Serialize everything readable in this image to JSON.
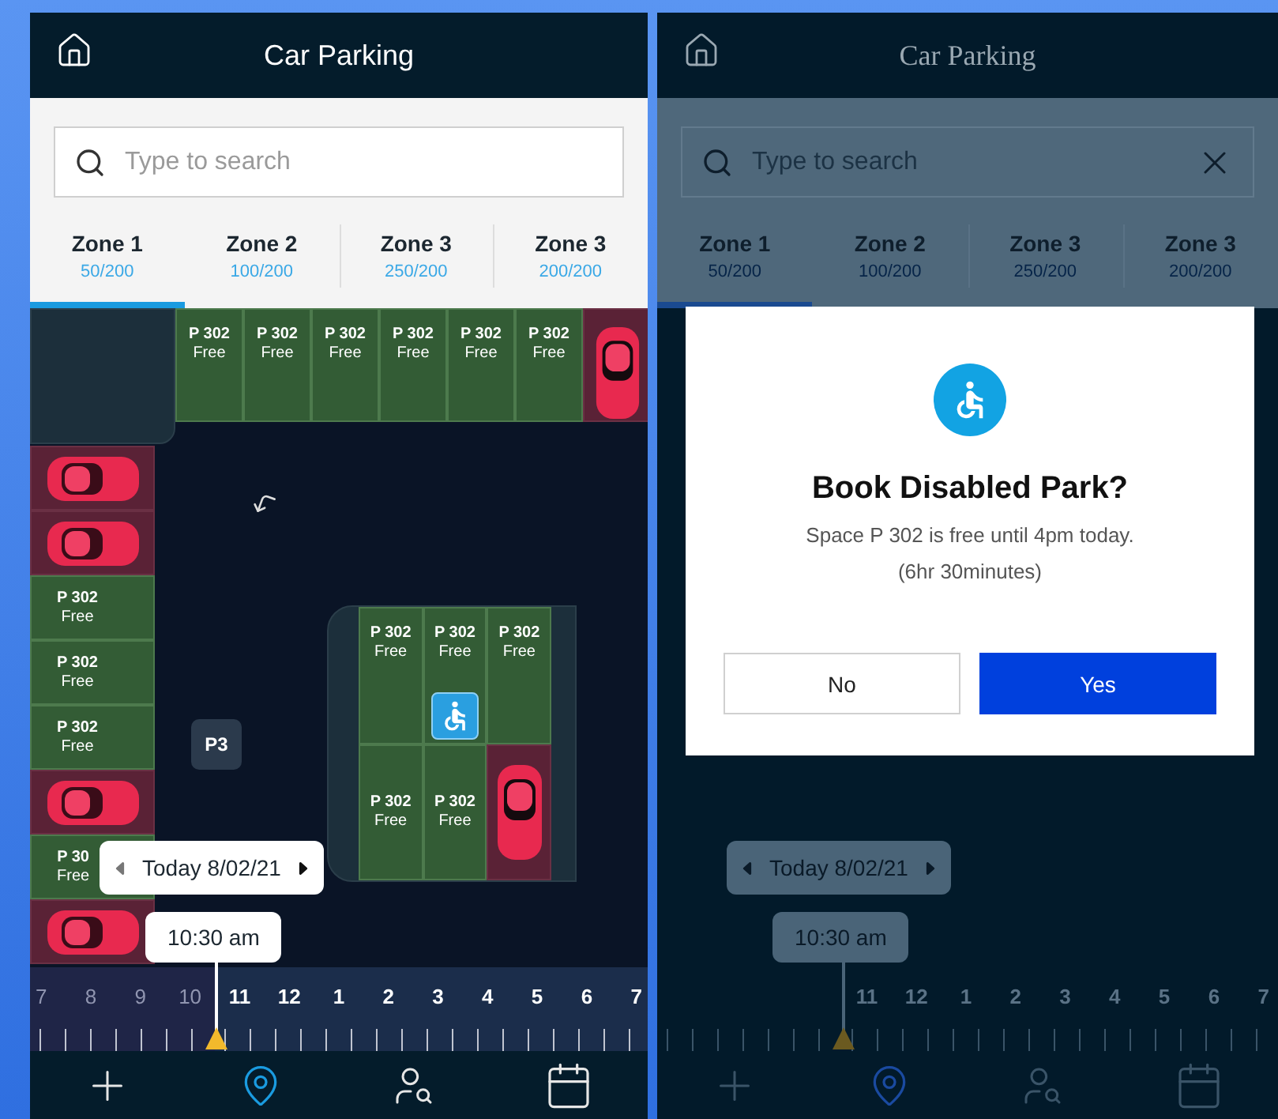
{
  "screens": [
    {
      "dimmed": false,
      "header": {
        "title": "Car Parking"
      },
      "search": {
        "placeholder": "Type to search",
        "clearable": false
      },
      "zones": [
        {
          "name": "Zone 1",
          "count": "50/200",
          "selected": true
        },
        {
          "name": "Zone 2",
          "count": "100/200",
          "selected": false
        },
        {
          "name": "Zone 3",
          "count": "250/200",
          "selected": false
        },
        {
          "name": "Zone 3",
          "count": "200/200",
          "selected": false
        }
      ],
      "map": {
        "marker": "P3",
        "top_row": [
          {
            "kind": "free",
            "label": "P 302",
            "status": "Free",
            "accessible": false
          },
          {
            "kind": "free",
            "label": "P 302",
            "status": "Free",
            "accessible": false
          },
          {
            "kind": "free",
            "label": "P 302",
            "status": "Free",
            "accessible": false
          },
          {
            "kind": "free",
            "label": "P 302",
            "status": "Free",
            "accessible": false
          },
          {
            "kind": "free",
            "label": "P 302",
            "status": "Free",
            "accessible": false
          },
          {
            "kind": "free",
            "label": "P 302",
            "status": "Free",
            "accessible": false
          },
          {
            "kind": "occupied",
            "accessible": false
          }
        ],
        "left_column": [
          {
            "kind": "occupied",
            "accessible": false
          },
          {
            "kind": "occupied",
            "accessible": false
          },
          {
            "kind": "free",
            "label": "P 302",
            "status": "Free",
            "accessible": false
          },
          {
            "kind": "free",
            "label": "P 302",
            "status": "Free",
            "accessible": false
          },
          {
            "kind": "free",
            "label": "P 302",
            "status": "Free",
            "accessible": false
          },
          {
            "kind": "occupied",
            "accessible": false
          },
          {
            "kind": "free",
            "label": "P 30",
            "status": "Free",
            "accessible": false
          },
          {
            "kind": "occupied",
            "accessible": false
          }
        ],
        "island": [
          {
            "kind": "free",
            "label": "P 302",
            "status": "Free",
            "accessible": false
          },
          {
            "kind": "free",
            "label": "P 302",
            "status": "Free",
            "accessible": true
          },
          {
            "kind": "free",
            "label": "P 302",
            "status": "Free",
            "accessible": false
          },
          {
            "kind": "free",
            "label": "P 302",
            "status": "Free",
            "accessible": false
          },
          {
            "kind": "free",
            "label": "P 302",
            "status": "Free",
            "accessible": false
          },
          {
            "kind": "occupied",
            "accessible": false
          }
        ]
      },
      "date": "Today 8/02/21",
      "time": "10:30 am",
      "hours": [
        {
          "label": "7",
          "past": true
        },
        {
          "label": "8",
          "past": true
        },
        {
          "label": "9",
          "past": true
        },
        {
          "label": "10",
          "past": true
        },
        {
          "label": "11",
          "past": false
        },
        {
          "label": "12",
          "past": false
        },
        {
          "label": "1",
          "past": false
        },
        {
          "label": "2",
          "past": false
        },
        {
          "label": "3",
          "past": false
        },
        {
          "label": "4",
          "past": false
        },
        {
          "label": "5",
          "past": false
        },
        {
          "label": "6",
          "past": false
        },
        {
          "label": "7",
          "past": false
        }
      ],
      "nav": [
        {
          "kind": "add",
          "selected": false
        },
        {
          "kind": "location",
          "selected": true
        },
        {
          "kind": "find-person",
          "selected": false
        },
        {
          "kind": "calendar",
          "selected": false
        }
      ]
    },
    {
      "dimmed": true,
      "header": {
        "title": "Car Parking"
      },
      "search": {
        "placeholder": "Type to search",
        "clearable": true
      },
      "zones": [
        {
          "name": "Zone 1",
          "count": "50/200",
          "selected": true
        },
        {
          "name": "Zone 2",
          "count": "100/200",
          "selected": false
        },
        {
          "name": "Zone 3",
          "count": "250/200",
          "selected": false
        },
        {
          "name": "Zone 3",
          "count": "200/200",
          "selected": false
        }
      ],
      "dialog": {
        "title": "Book Disabled Park?",
        "lines": [
          "Space P 302 is free until 4pm today.",
          "(6hr 30minutes)"
        ],
        "buttons": [
          {
            "label": "No",
            "kind": "secondary"
          },
          {
            "label": "Yes",
            "kind": "primary"
          }
        ]
      },
      "date": "Today 8/02/21",
      "time": "10:30 am",
      "hours": [
        {
          "label": "11",
          "past": false
        },
        {
          "label": "12",
          "past": false
        },
        {
          "label": "1",
          "past": false
        },
        {
          "label": "2",
          "past": false
        },
        {
          "label": "3",
          "past": false
        },
        {
          "label": "4",
          "past": false
        },
        {
          "label": "5",
          "past": false
        },
        {
          "label": "6",
          "past": false
        },
        {
          "label": "7",
          "past": false
        }
      ],
      "nav": [
        {
          "kind": "add",
          "selected": false
        },
        {
          "kind": "location",
          "selected": true
        },
        {
          "kind": "find-person",
          "selected": false
        },
        {
          "kind": "calendar",
          "selected": false
        }
      ]
    }
  ]
}
